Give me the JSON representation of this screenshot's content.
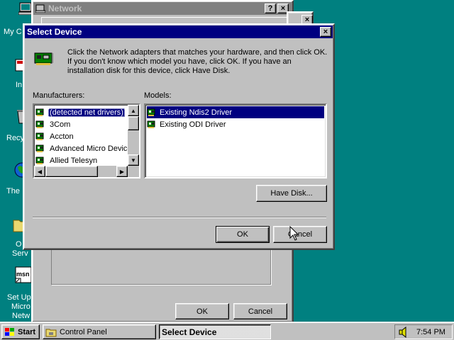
{
  "desktop": {
    "icons": [
      {
        "label": "My C"
      },
      {
        "label": "In"
      },
      {
        "label": "Recy"
      },
      {
        "label": "The I"
      },
      {
        "label": "O"
      },
      {
        "label": "Serv"
      },
      {
        "label": "Set Up"
      },
      {
        "label": "Micro"
      },
      {
        "label": "Netw"
      }
    ]
  },
  "network_window": {
    "title": "Network",
    "ok_label": "OK",
    "cancel_label": "Cancel"
  },
  "dialog": {
    "title": "Select Device",
    "instructions": "Click the Network adapters that matches your hardware, and then click OK. If you don't know which model you have, click OK. If you have an installation disk for this device, click Have Disk.",
    "manufacturers_label": "Manufacturers:",
    "manufacturers": [
      "(detected net drivers)",
      "3Com",
      "Accton",
      "Advanced Micro Devices",
      "Allied Telesyn"
    ],
    "selected_manufacturer": 0,
    "models_label": "Models:",
    "models": [
      "Existing Ndis2 Driver",
      "Existing ODI Driver"
    ],
    "selected_model": 0,
    "have_disk_label": "Have Disk...",
    "ok_label": "OK",
    "cancel_label": "Cancel"
  },
  "taskbar": {
    "start_label": "Start",
    "tasks": [
      {
        "label": "Control Panel",
        "active": false
      },
      {
        "label": "Select Device",
        "active": true
      }
    ],
    "clock": "7:54 PM"
  }
}
